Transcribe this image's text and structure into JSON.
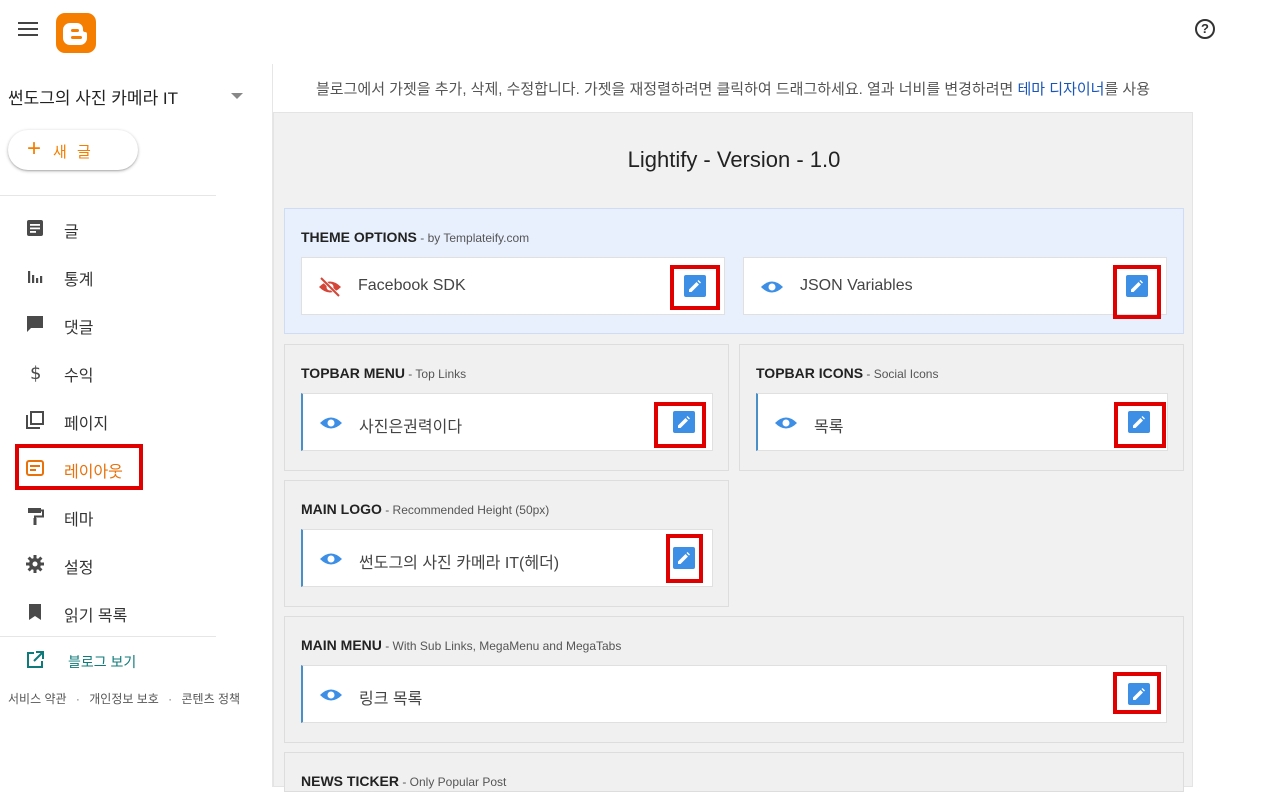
{
  "colors": {
    "accent": "#f57d00",
    "active_nav": "#e8710a",
    "highlight": "#e00000",
    "edit_button": "#3d8fe6",
    "link": "#1a56b8"
  },
  "header": {
    "menu_icon": "hamburger-icon",
    "logo_icon": "blogger-logo-icon",
    "help_icon": "help-circle-icon",
    "help_glyph": "?"
  },
  "sidebar": {
    "blog_name": "썬도그의 사진 카메라 IT",
    "new_post": {
      "plus": "+",
      "label": "새 글"
    },
    "items": [
      {
        "label": "글",
        "icon": "posts-icon"
      },
      {
        "label": "통계",
        "icon": "stats-icon"
      },
      {
        "label": "댓글",
        "icon": "comments-icon"
      },
      {
        "label": "수익",
        "icon": "dollar-icon"
      },
      {
        "label": "페이지",
        "icon": "pages-icon"
      },
      {
        "label": "레이아웃",
        "icon": "layout-icon",
        "active": true
      },
      {
        "label": "테마",
        "icon": "paint-roller-icon"
      },
      {
        "label": "설정",
        "icon": "gear-icon"
      },
      {
        "label": "읽기 목록",
        "icon": "bookmark-icon"
      }
    ],
    "view_blog": "블로그 보기",
    "footer": {
      "terms": "서비스 약관",
      "privacy": "개인정보 보호",
      "content_policy": "콘텐츠 정책",
      "separator": "·"
    }
  },
  "main": {
    "hint_text": "블로그에서 가젯을 추가, 삭제, 수정합니다. 가젯을 재정렬하려면 클릭하여 드래그하세요. 열과 너비를 변경하려면 ",
    "hint_link": "테마 디자이너",
    "hint_suffix": "를 사용",
    "template_title": "Lightify - Version - 1.0",
    "sections": {
      "theme_options": {
        "title": "THEME OPTIONS",
        "subtitle": " - by Templateify.com",
        "gadgets": [
          {
            "name": "Facebook SDK",
            "icon": "eye-off-icon"
          },
          {
            "name": "JSON Variables",
            "icon": "eye-icon"
          }
        ]
      },
      "topbar_menu": {
        "title": "TOPBAR MENU",
        "subtitle": " - Top Links",
        "gadgets": [
          {
            "name": "사진은권력이다",
            "icon": "eye-icon"
          }
        ]
      },
      "topbar_icons": {
        "title": "TOPBAR ICONS",
        "subtitle": " - Social Icons",
        "gadgets": [
          {
            "name": "목록",
            "icon": "eye-icon"
          }
        ]
      },
      "main_logo": {
        "title": "MAIN LOGO",
        "subtitle": " - Recommended Height (50px)",
        "gadgets": [
          {
            "name": "썬도그의 사진 카메라 IT(헤더)",
            "icon": "eye-icon"
          }
        ]
      },
      "main_menu": {
        "title": "MAIN MENU",
        "subtitle": " - With Sub Links, MegaMenu and MegaTabs",
        "gadgets": [
          {
            "name": "링크 목록",
            "icon": "eye-icon"
          }
        ]
      },
      "news_ticker": {
        "title": "NEWS TICKER",
        "subtitle": " - Only Popular Post"
      }
    }
  }
}
